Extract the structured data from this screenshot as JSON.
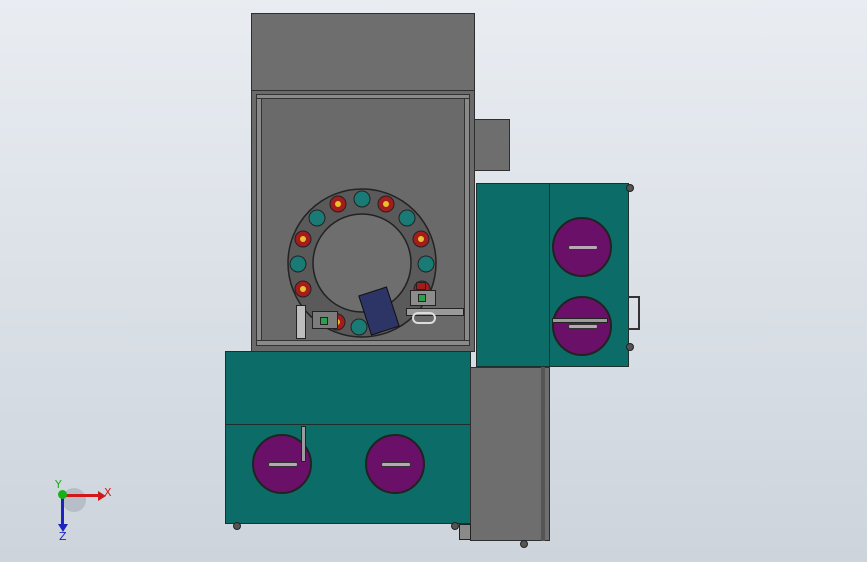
{
  "viewport": {
    "background_top": "#e9edf2",
    "background_bottom": "#cdd4dc"
  },
  "model": {
    "colors": {
      "frame": "#6e6e6e",
      "panel": "#0c6d68",
      "disc": "#6a1069",
      "carousel": "#5a5a5a",
      "station_teal": "#1a7a76",
      "station_red": "#a41c1c",
      "part": "#2d3566"
    }
  },
  "triad": {
    "x_label": "X",
    "y_label": "Y",
    "z_label": "Z",
    "x_color": "#d01818",
    "y_color": "#18b018",
    "z_color": "#1c24c0"
  }
}
